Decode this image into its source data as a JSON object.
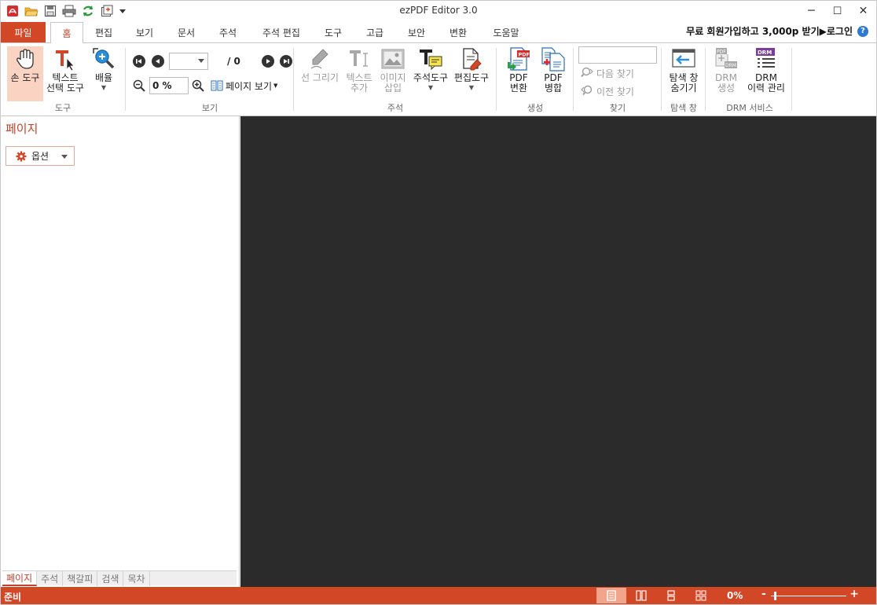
{
  "app": {
    "title": "ezPDF Editor 3.0"
  },
  "quick_access": [
    "app-logo-icon",
    "open-folder-icon",
    "save-icon",
    "print-icon",
    "refresh-icon",
    "export-icon",
    "qat-dropdown-icon"
  ],
  "window_controls": {
    "minimize": "─",
    "maximize": "☐",
    "close": "✕"
  },
  "tabs": {
    "file": "파일",
    "items": [
      "홈",
      "편집",
      "보기",
      "문서",
      "주석",
      "주석 편집",
      "도구",
      "고급",
      "보안",
      "변환",
      "도움말"
    ],
    "active": "홈"
  },
  "promo": {
    "text": "무료 회원가입하고 3,000p 받기▶로그인",
    "help": "?"
  },
  "ribbon": {
    "tools": {
      "label": "도구",
      "hand": "손 도구",
      "text_select": "텍스트\n선택 도구",
      "zoom": "배율"
    },
    "view": {
      "label": "보기",
      "page_total": "/ 0",
      "zoom_value": "0 %",
      "page_view": "페이지 보기"
    },
    "annotation": {
      "label": "주석",
      "draw_line": "선 그리기",
      "add_text": "텍스트\n추가",
      "insert_image": "이미지\n삽입",
      "annot_tool": "주석도구",
      "edit_tool": "편집도구"
    },
    "create": {
      "label": "생성",
      "pdf_convert": "PDF\n변환",
      "pdf_merge": "PDF\n병합"
    },
    "find": {
      "label": "찾기",
      "find_next": "다음 찾기",
      "find_prev": "이전 찾기",
      "search_value": ""
    },
    "explorer": {
      "label": "탐색 창",
      "hide": "탐색 창\n숨기기"
    },
    "drm": {
      "label": "DRM 서비스",
      "create": "DRM\n생성",
      "history": "DRM\n이력 관리"
    }
  },
  "left_panel": {
    "title": "페이지",
    "options": "옵션",
    "bottom_tabs": [
      "페이지",
      "주석",
      "책갈피",
      "검색",
      "목차"
    ],
    "active_tab": "페이지"
  },
  "status": {
    "text": "준비",
    "zoom": "0%",
    "minus": "-",
    "plus": "+",
    "zoom_level": 0
  },
  "colors": {
    "accent": "#d24726",
    "accent_text": "#c4422a",
    "doc_bg": "#2b2b2b"
  }
}
